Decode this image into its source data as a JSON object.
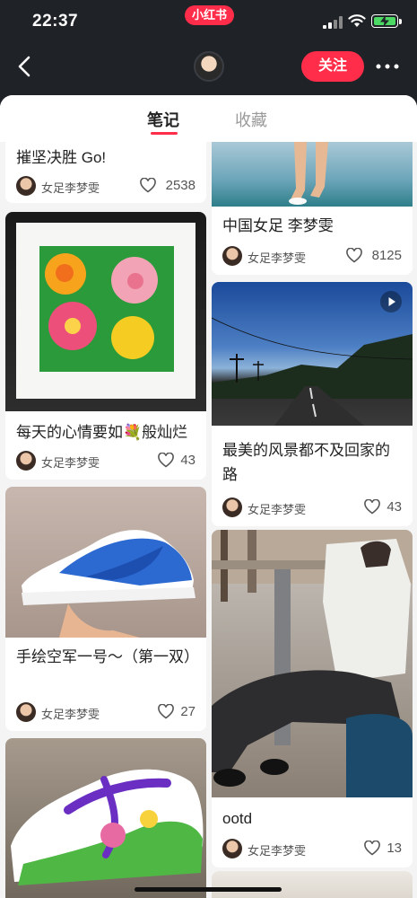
{
  "status_bar": {
    "time": "22:37",
    "app_badge": "小红书"
  },
  "nav": {
    "follow_label": "关注"
  },
  "tabs": [
    {
      "label": "笔记",
      "active": true
    },
    {
      "label": "收藏",
      "active": false
    }
  ],
  "colors": {
    "accent": "#ff2d49",
    "header_bg": "#1f2227",
    "feed_bg": "#f4f4f4"
  },
  "author_name": "女足李梦雯",
  "left_column": [
    {
      "title": "摧坚决胜 Go!",
      "likes": "2538",
      "image": "partial-top"
    },
    {
      "title": "每天的心情要如💐般灿烂",
      "likes": "43",
      "image": "flower-painting"
    },
    {
      "title": "手绘空军一号～（第一双）",
      "likes": "27",
      "image": "blue-painted-sneaker"
    },
    {
      "title": "",
      "likes": "",
      "image": "green-painted-sneaker"
    }
  ],
  "right_column": [
    {
      "title": "中国女足 李梦雯",
      "likes": "8125",
      "image": "legs-on-court"
    },
    {
      "title": "最美的风景都不及回家的路",
      "likes": "43",
      "image": "evening-road",
      "video": true
    },
    {
      "title": "ootd",
      "likes": "13",
      "image": "outfit-photo"
    }
  ]
}
